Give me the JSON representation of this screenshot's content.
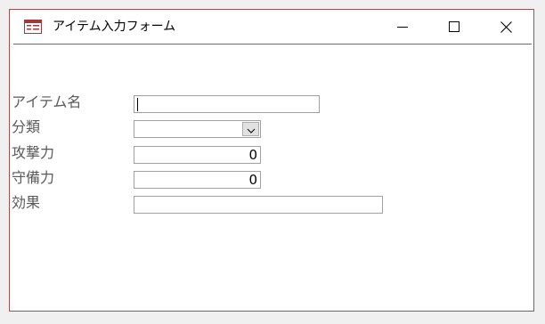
{
  "window": {
    "title": "アイテム入力フォーム"
  },
  "icons": {
    "app": "form-app-icon",
    "minimize": "minimize-icon",
    "maximize": "maximize-icon",
    "close": "close-icon",
    "dropdown": "chevron-down-icon"
  },
  "colors": {
    "window_border": "#a05050",
    "label_text": "#5a5a5a",
    "field_border": "#a0a0a0"
  },
  "form": {
    "fields": [
      {
        "label": "アイテム名",
        "value": ""
      },
      {
        "label": "分類",
        "value": ""
      },
      {
        "label": "攻撃力",
        "value": "0"
      },
      {
        "label": "守備力",
        "value": "0"
      },
      {
        "label": "効果",
        "value": ""
      }
    ]
  }
}
